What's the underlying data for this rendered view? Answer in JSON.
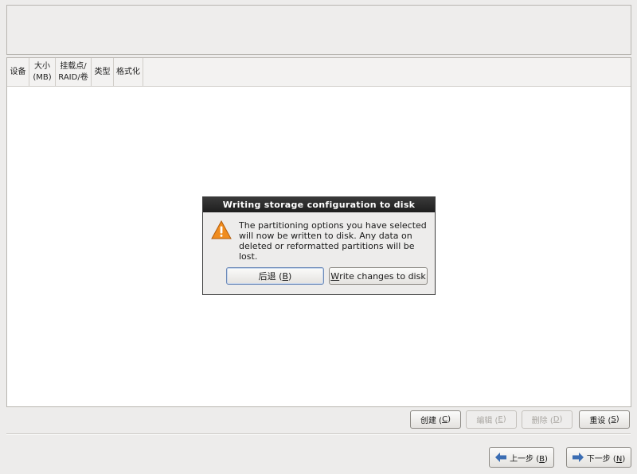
{
  "table": {
    "columns": [
      {
        "line1": "设备",
        "line2": ""
      },
      {
        "line1": "大小",
        "line2": "(MB)"
      },
      {
        "line1": "挂载点/",
        "line2": "RAID/卷"
      },
      {
        "line1": "类型",
        "line2": ""
      },
      {
        "line1": "格式化",
        "line2": ""
      }
    ]
  },
  "dialog": {
    "title": "Writing storage configuration to disk",
    "message": "The partitioning options you have selected will now be written to disk.  Any data on deleted or reformatted partitions will be lost.",
    "back_label": "后退 (",
    "back_mnemonic": "B",
    "back_suffix": ")",
    "write_mnemonic": "W",
    "write_label": "rite changes to disk",
    "icon": "warning-icon"
  },
  "actions": {
    "create_label": "创建 (",
    "create_mnemonic": "C",
    "edit_label": "编辑 (",
    "edit_mnemonic": "E",
    "delete_label": "删除 (",
    "delete_mnemonic": "D",
    "reset_label": "重设 (",
    "reset_mnemonic": "S",
    "close_paren": ")"
  },
  "nav": {
    "back_label": "上一步 (",
    "back_mnemonic": "B",
    "next_label": "下一步 (",
    "next_mnemonic": "N",
    "close_paren": ")",
    "back_icon": "arrow-left-icon",
    "next_icon": "arrow-right-icon"
  },
  "colors": {
    "dialog_title_bg": "#2a2a2a",
    "arrow_blue": "#3b6db3",
    "warning_orange": "#f08c1e"
  }
}
